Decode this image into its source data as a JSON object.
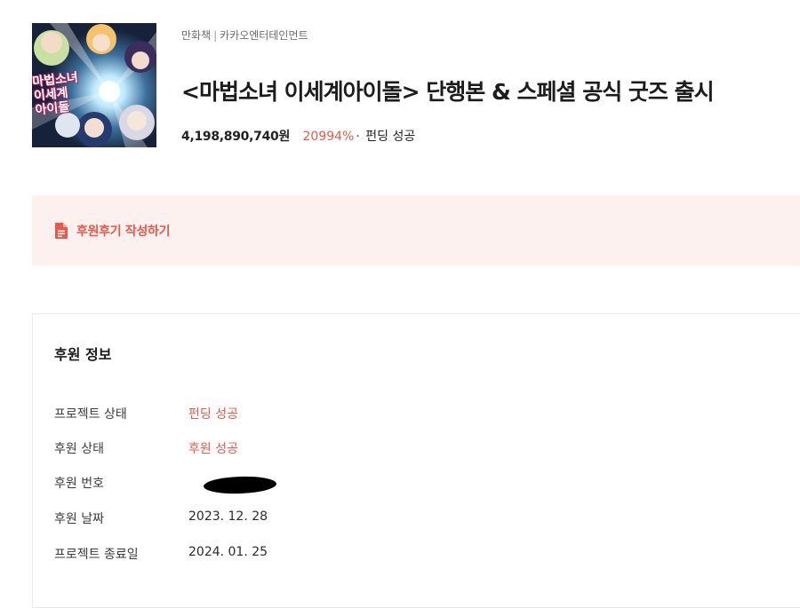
{
  "project": {
    "cover": {
      "alt_title": "마법소녀 이세계 아이돌"
    },
    "category": "만화책",
    "creator": "카카오엔터테인먼트",
    "separator": "|",
    "title": "<마법소녀 이세계아이돌> 단행본 & 스페셜 공식 굿즈 출시",
    "amount": "4,198,890,740원",
    "percent": "20994%",
    "dot": "·",
    "status": "펀딩 성공"
  },
  "review": {
    "icon": "document-icon",
    "label": "후원후기 작성하기"
  },
  "support_info": {
    "title": "후원 정보",
    "rows": [
      {
        "label": "프로젝트 상태",
        "value": "펀딩 성공",
        "accent": true
      },
      {
        "label": "후원 상태",
        "value": "후원 성공",
        "accent": true
      },
      {
        "label": "후원 번호",
        "value": "",
        "redacted": true
      },
      {
        "label": "후원 날짜",
        "value": "2023. 12. 28",
        "accent": false
      },
      {
        "label": "프로젝트 종료일",
        "value": "2024. 01. 25",
        "accent": false
      }
    ]
  },
  "colors": {
    "accent": "#e8594a",
    "banner_bg": "#fdf1f0"
  }
}
